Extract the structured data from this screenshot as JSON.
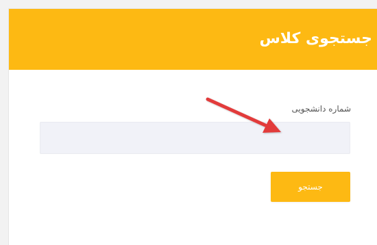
{
  "card": {
    "title": "جستجوی کلاس"
  },
  "form": {
    "student_number_label": "شماره دانشجویی",
    "student_number_value": "",
    "student_number_placeholder": "",
    "search_button_label": "جستجو"
  },
  "colors": {
    "header_background": "#fdb913",
    "button_background": "#fdb913",
    "input_background": "#f1f2f8",
    "annotation_arrow": "#e23b3b"
  },
  "icons": {
    "annotation": "red-pointer-arrow-icon"
  }
}
